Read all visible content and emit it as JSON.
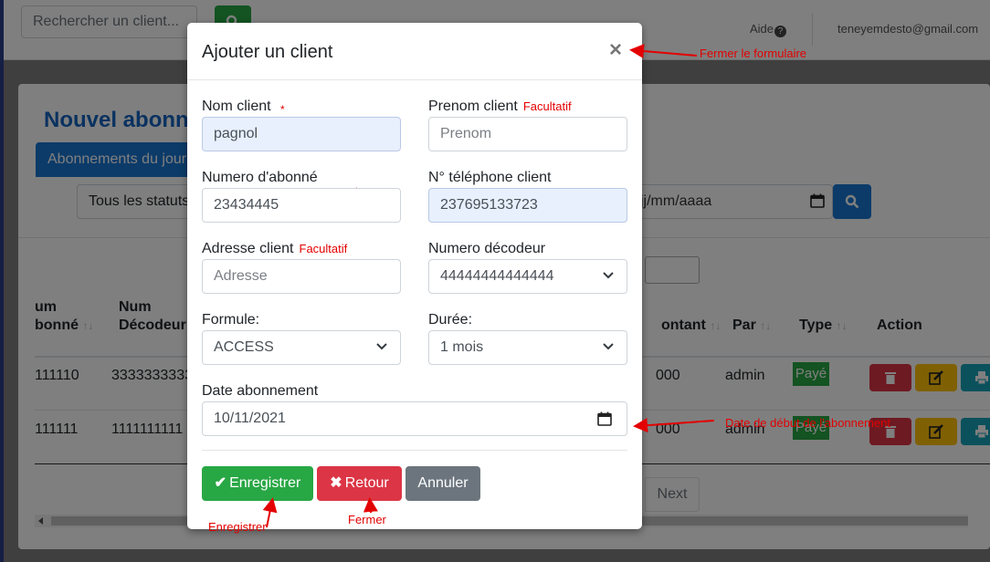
{
  "topbar": {
    "search_placeholder": "Rechercher un client...",
    "help_label": "Aide",
    "help_icon": "?",
    "user_email": "teneyemdesto@gmail.com"
  },
  "background": {
    "card_title": "Nouvel abonn",
    "tab_label": "Abonnements du jour",
    "status_filter": "Tous les statuts",
    "date_filter_placeholder": "jj/mm/aaaa",
    "table_headers": {
      "num_abonne_1": "um",
      "num_abonne_2": "bonné",
      "num_decodeur_1": "Num",
      "num_decodeur_2": "Décodeur",
      "montant": "ontant",
      "par": "Par",
      "type": "Type",
      "action": "Action"
    },
    "rows": [
      {
        "num_abonne": "111110",
        "num_decodeur": "3333333333",
        "montant": "000",
        "par": "admin",
        "type": "Payé"
      },
      {
        "num_abonne": "111111",
        "num_decodeur": "1111111111",
        "montant": "000",
        "par": "admin",
        "type": "Payé"
      }
    ],
    "next_label": "Next"
  },
  "modal": {
    "title": "Ajouter un client",
    "close_glyph": "×",
    "fields": {
      "nom_label": "Nom client",
      "nom_value": "pagnol",
      "prenom_label": "Prenom client",
      "prenom_optional": "Facultatif",
      "prenom_placeholder": "Prenom",
      "numero_abonne_label": "Numero d'abonné",
      "numero_abonne_value": "23434445",
      "telephone_label": "N° téléphone client",
      "telephone_value": "237695133723",
      "adresse_label": "Adresse client",
      "adresse_optional": "Facultatif",
      "adresse_placeholder": "Adresse",
      "decodeur_label": "Numero décodeur",
      "decodeur_value": "44444444444444",
      "formule_label": "Formule:",
      "formule_value": "ACCESS",
      "duree_label": "Durée:",
      "duree_value": "1 mois",
      "date_label": "Date abonnement",
      "date_value": "10/11/2021",
      "required_mark": "*"
    },
    "buttons": {
      "save": "Enregistrer",
      "save_icon": "✔",
      "back": "Retour",
      "back_icon": "✖",
      "cancel": "Annuler"
    }
  },
  "annotations": {
    "close": "Fermer le formulaire",
    "date": "Date de début de l'abonnement",
    "save": "Enregistrer",
    "back": "Fermer"
  },
  "colors": {
    "accent_blue": "#1976d2",
    "success": "#28a745",
    "danger": "#dc3545",
    "warning": "#ffc107",
    "secondary": "#6c757d",
    "annotation_red": "#e30000"
  }
}
